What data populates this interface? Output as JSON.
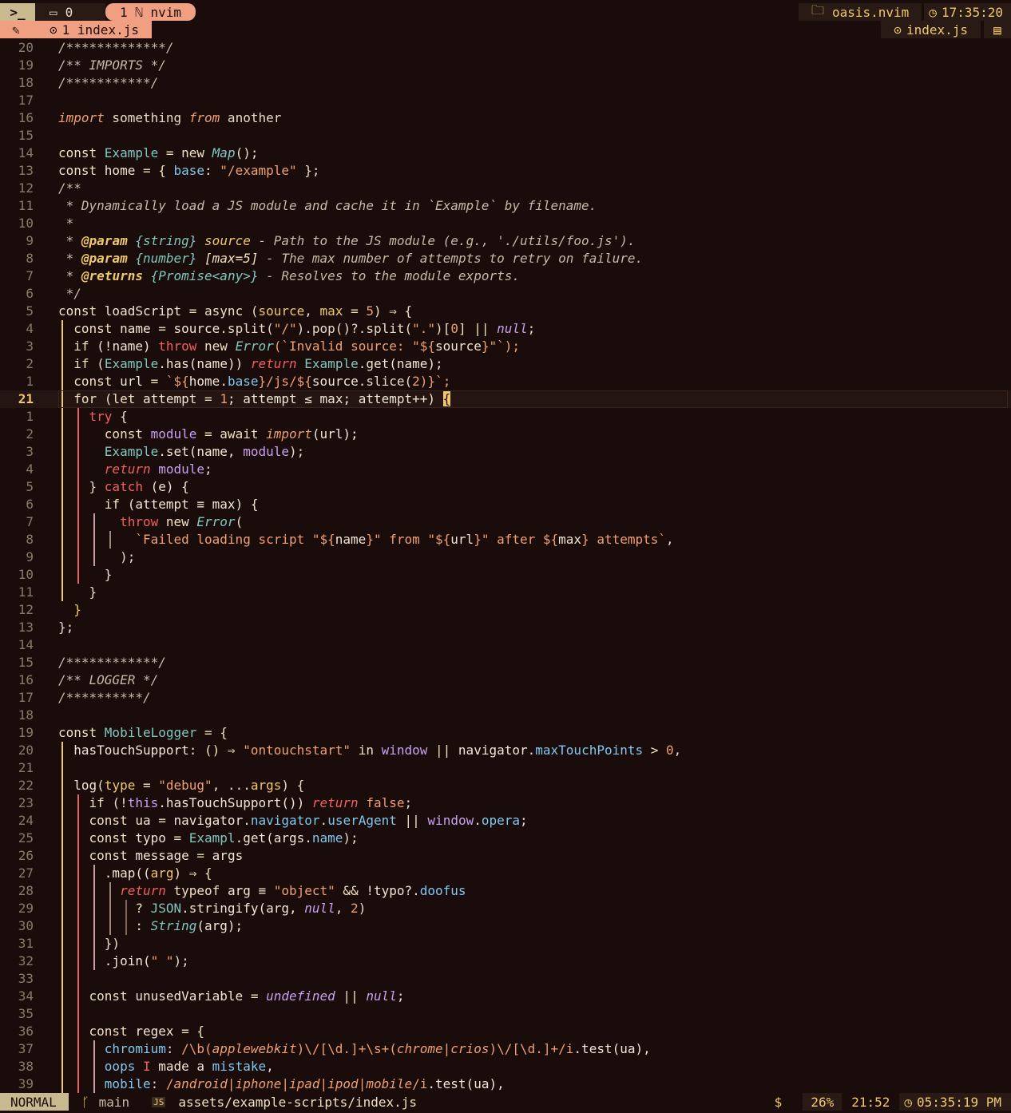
{
  "topbar": {
    "terminal_icon": "terminal-icon",
    "session_count": "0",
    "window_label": "1 ℕ nvim",
    "project": "oasis.nvim",
    "clock": "17:35:20"
  },
  "tabline": {
    "tab_label": "1 index.js",
    "right_file": "index.js"
  },
  "statusline": {
    "mode": "NORMAL",
    "branch": "main",
    "filepath": "assets/example-scripts/index.js",
    "dollar": "$",
    "percent": "26%",
    "position": "21:52",
    "time": "05:35:19 PM"
  },
  "colors": {
    "background": "#1a0c0a",
    "accent": "#f0c96a",
    "keyword": "#f0e0c0",
    "string": "#f0a070",
    "comment": "#c8b8a8",
    "function": "#80c8c0",
    "property": "#80c8f0",
    "purple": "#c8a0f0",
    "red": "#f06060"
  },
  "lines": [
    {
      "n": "20",
      "segs": [
        [
          "/*************/",
          "cm"
        ]
      ]
    },
    {
      "n": "19",
      "segs": [
        [
          "/** IMPORTS */",
          "cm"
        ]
      ]
    },
    {
      "n": "18",
      "segs": [
        [
          "/***********/",
          "cm"
        ]
      ]
    },
    {
      "n": "17",
      "segs": []
    },
    {
      "n": "16",
      "segs": [
        [
          "import",
          "kwi"
        ],
        [
          " something ",
          ""
        ],
        [
          "from",
          "kwi"
        ],
        [
          " another",
          ""
        ]
      ]
    },
    {
      "n": "15",
      "segs": []
    },
    {
      "n": "14",
      "segs": [
        [
          "const ",
          "kw"
        ],
        [
          "Example",
          "fn"
        ],
        [
          " = ",
          "op"
        ],
        [
          "new ",
          "kw"
        ],
        [
          "Map",
          "fni"
        ],
        [
          "();",
          "p"
        ]
      ]
    },
    {
      "n": "13",
      "segs": [
        [
          "const ",
          "kw"
        ],
        [
          "home",
          "id"
        ],
        [
          " = { ",
          "op"
        ],
        [
          "base",
          "pr"
        ],
        [
          ": ",
          "op"
        ],
        [
          "\"/example\"",
          "str"
        ],
        [
          " };",
          "p"
        ]
      ]
    },
    {
      "n": "12",
      "segs": [
        [
          "/**",
          "cm"
        ]
      ]
    },
    {
      "n": "11",
      "segs": [
        [
          " * Dynamically load a JS module and cache it in `Example` by filename.",
          "cm"
        ]
      ]
    },
    {
      "n": "10",
      "segs": [
        [
          " *",
          "cm"
        ]
      ]
    },
    {
      "n": "9",
      "segs": [
        [
          " * ",
          "cm"
        ],
        [
          "@param",
          "tag"
        ],
        [
          " ",
          "cm"
        ],
        [
          "{string}",
          "ty"
        ],
        [
          " ",
          "cm"
        ],
        [
          "source",
          "sym"
        ],
        [
          " - Path to the JS module (e.g., './utils/foo.js').",
          "cm"
        ]
      ]
    },
    {
      "n": "8",
      "segs": [
        [
          " * ",
          "cm"
        ],
        [
          "@param",
          "tag"
        ],
        [
          " ",
          "cm"
        ],
        [
          "{number}",
          "ty"
        ],
        [
          " ",
          "cm"
        ],
        [
          "[max=5]",
          "syb"
        ],
        [
          " - The max number of attempts to retry on failure.",
          "cm"
        ]
      ]
    },
    {
      "n": "7",
      "segs": [
        [
          " * ",
          "cm"
        ],
        [
          "@returns",
          "tag"
        ],
        [
          " ",
          "cm"
        ],
        [
          "{Promise<any>}",
          "ty"
        ],
        [
          " - Resolves to the module exports.",
          "cm"
        ]
      ]
    },
    {
      "n": "6",
      "segs": [
        [
          " */",
          "cm"
        ]
      ]
    },
    {
      "n": "5",
      "segs": [
        [
          "const ",
          "kw"
        ],
        [
          "loadScript",
          "id"
        ],
        [
          " = ",
          "op"
        ],
        [
          "async ",
          "kw"
        ],
        [
          "(",
          "p"
        ],
        [
          "source",
          "par"
        ],
        [
          ", ",
          "p"
        ],
        [
          "max",
          "par"
        ],
        [
          " = ",
          "op"
        ],
        [
          "5",
          "num"
        ],
        [
          ") ⇒ {",
          "op"
        ]
      ]
    },
    {
      "n": "4",
      "g": [
        1
      ],
      "segs": [
        [
          "  const ",
          "kw"
        ],
        [
          "name",
          "id"
        ],
        [
          " = ",
          "op"
        ],
        [
          "source",
          "id"
        ],
        [
          ".split(",
          "p"
        ],
        [
          "\"/\"",
          "str"
        ],
        [
          ").pop()?.split(",
          "p"
        ],
        [
          "\".\"",
          "str"
        ],
        [
          ")[",
          "p"
        ],
        [
          "0",
          "num"
        ],
        [
          "] || ",
          "op"
        ],
        [
          "null",
          "nul"
        ],
        [
          ";",
          "p"
        ]
      ]
    },
    {
      "n": "3",
      "g": [
        1
      ],
      "segs": [
        [
          "  if ",
          "kw"
        ],
        [
          "(!name) ",
          "id"
        ],
        [
          "throw ",
          "red"
        ],
        [
          "new ",
          "kw"
        ],
        [
          "Error",
          "fni"
        ],
        [
          "(`Invalid source: \"${",
          "str"
        ],
        [
          "source",
          "id"
        ],
        [
          "}\"`);",
          "str"
        ]
      ]
    },
    {
      "n": "2",
      "g": [
        1
      ],
      "segs": [
        [
          "  if ",
          "kw"
        ],
        [
          "(",
          "p"
        ],
        [
          "Example",
          "fn"
        ],
        [
          ".has(name)) ",
          "id"
        ],
        [
          "return ",
          "redi"
        ],
        [
          "Example",
          "fn"
        ],
        [
          ".get(name);",
          "id"
        ]
      ]
    },
    {
      "n": "1",
      "g": [
        1
      ],
      "segs": [
        [
          "  const ",
          "kw"
        ],
        [
          "url",
          "id"
        ],
        [
          " = ",
          "op"
        ],
        [
          "`${",
          "str"
        ],
        [
          "home",
          "id"
        ],
        [
          ".",
          "p"
        ],
        [
          "base",
          "pr"
        ],
        [
          "}/js/${",
          "str"
        ],
        [
          "source",
          "id"
        ],
        [
          ".slice(",
          "p"
        ],
        [
          "2",
          "num"
        ],
        [
          ")}`;",
          "str"
        ]
      ]
    },
    {
      "n": "21",
      "cur": true,
      "g": [
        1
      ],
      "segs": [
        [
          "  for ",
          "kw"
        ],
        [
          "(",
          "p"
        ],
        [
          "let ",
          "kw"
        ],
        [
          "attempt",
          "id"
        ],
        [
          " = ",
          "op"
        ],
        [
          "1",
          "num"
        ],
        [
          "; attempt ≤ max; attempt++) ",
          "id"
        ],
        [
          "{",
          "cursor"
        ]
      ]
    },
    {
      "n": "1",
      "g": [
        1,
        2
      ],
      "segs": [
        [
          "    try ",
          "red"
        ],
        [
          "{",
          "p"
        ]
      ]
    },
    {
      "n": "2",
      "g": [
        1,
        2
      ],
      "segs": [
        [
          "      const ",
          "kw"
        ],
        [
          "module",
          "pu"
        ],
        [
          " = ",
          "op"
        ],
        [
          "await ",
          "kw"
        ],
        [
          "import",
          "kwi"
        ],
        [
          "(url);",
          "id"
        ]
      ]
    },
    {
      "n": "3",
      "g": [
        1,
        2
      ],
      "segs": [
        [
          "      Example",
          "fn"
        ],
        [
          ".set(name, ",
          "id"
        ],
        [
          "module",
          "pu"
        ],
        [
          ");",
          "p"
        ]
      ]
    },
    {
      "n": "4",
      "g": [
        1,
        2
      ],
      "segs": [
        [
          "      return ",
          "redi"
        ],
        [
          "module",
          "pu"
        ],
        [
          ";",
          "p"
        ]
      ]
    },
    {
      "n": "5",
      "g": [
        1,
        2
      ],
      "segs": [
        [
          "    } ",
          "p"
        ],
        [
          "catch ",
          "red"
        ],
        [
          "(e) {",
          "id"
        ]
      ]
    },
    {
      "n": "6",
      "g": [
        1,
        2
      ],
      "segs": [
        [
          "      if ",
          "kw"
        ],
        [
          "(attempt ≡ max) {",
          "id"
        ]
      ]
    },
    {
      "n": "7",
      "g": [
        1,
        2,
        3
      ],
      "segs": [
        [
          "        throw ",
          "red"
        ],
        [
          "new ",
          "kw"
        ],
        [
          "Error",
          "fni"
        ],
        [
          "(",
          "p"
        ]
      ]
    },
    {
      "n": "8",
      "g": [
        1,
        2,
        3,
        4
      ],
      "segs": [
        [
          "          `Failed loading script \"${",
          "str"
        ],
        [
          "name",
          "id"
        ],
        [
          "}\" from \"${",
          "str"
        ],
        [
          "url",
          "id"
        ],
        [
          "}\" after ${",
          "str"
        ],
        [
          "max",
          "id"
        ],
        [
          "} attempts`",
          "str"
        ],
        [
          ",",
          "p"
        ]
      ]
    },
    {
      "n": "9",
      "g": [
        1,
        2,
        3
      ],
      "segs": [
        [
          "        );",
          "p"
        ]
      ]
    },
    {
      "n": "10",
      "g": [
        1,
        2
      ],
      "segs": [
        [
          "      }",
          "p"
        ]
      ]
    },
    {
      "n": "11",
      "g": [
        1
      ],
      "segs": [
        [
          "    }",
          "p"
        ]
      ]
    },
    {
      "n": "12",
      "g": [],
      "segs": [
        [
          "  }",
          "acc"
        ]
      ]
    },
    {
      "n": "13",
      "segs": [
        [
          "};",
          "p"
        ]
      ]
    },
    {
      "n": "14",
      "segs": []
    },
    {
      "n": "15",
      "segs": [
        [
          "/************/",
          "cm"
        ]
      ]
    },
    {
      "n": "16",
      "segs": [
        [
          "/** LOGGER */",
          "cm"
        ]
      ]
    },
    {
      "n": "17",
      "segs": [
        [
          "/**********/",
          "cm"
        ]
      ]
    },
    {
      "n": "18",
      "segs": []
    },
    {
      "n": "19",
      "segs": [
        [
          "const ",
          "kw"
        ],
        [
          "MobileLogger",
          "fn"
        ],
        [
          " = {",
          "op"
        ]
      ]
    },
    {
      "n": "20",
      "g": [
        1
      ],
      "segs": [
        [
          "  hasTouchSupport",
          "id"
        ],
        [
          ": () ⇒ ",
          "op"
        ],
        [
          "\"ontouchstart\"",
          "str"
        ],
        [
          " in ",
          "kw"
        ],
        [
          "window",
          "pu"
        ],
        [
          " || ",
          "op"
        ],
        [
          "navigator",
          "id"
        ],
        [
          ".",
          "p"
        ],
        [
          "maxTouchPoints",
          "pr"
        ],
        [
          " > ",
          "op"
        ],
        [
          "0",
          "num"
        ],
        [
          ",",
          "p"
        ]
      ]
    },
    {
      "n": "21",
      "g": [
        1
      ],
      "segs": []
    },
    {
      "n": "22",
      "g": [
        1
      ],
      "segs": [
        [
          "  log",
          "id"
        ],
        [
          "(",
          "p"
        ],
        [
          "type",
          "par"
        ],
        [
          " = ",
          "op"
        ],
        [
          "\"debug\"",
          "str"
        ],
        [
          ", ...",
          "p"
        ],
        [
          "args",
          "par"
        ],
        [
          ") {",
          "p"
        ]
      ]
    },
    {
      "n": "23",
      "g": [
        1,
        2
      ],
      "segs": [
        [
          "    if ",
          "kw"
        ],
        [
          "(!",
          "p"
        ],
        [
          "this",
          "pu"
        ],
        [
          ".hasTouchSupport()) ",
          "id"
        ],
        [
          "return ",
          "redi"
        ],
        [
          "false",
          "str"
        ],
        [
          ";",
          "p"
        ]
      ]
    },
    {
      "n": "24",
      "g": [
        1,
        2
      ],
      "segs": [
        [
          "    const ",
          "kw"
        ],
        [
          "ua",
          "id"
        ],
        [
          " = ",
          "op"
        ],
        [
          "navigator",
          "id"
        ],
        [
          ".",
          "p"
        ],
        [
          "navigator",
          "pr"
        ],
        [
          ".",
          "p"
        ],
        [
          "userAgent",
          "pr"
        ],
        [
          " || ",
          "op"
        ],
        [
          "window",
          "pu"
        ],
        [
          ".",
          "p"
        ],
        [
          "opera",
          "pr"
        ],
        [
          ";",
          "p"
        ]
      ]
    },
    {
      "n": "25",
      "g": [
        1,
        2
      ],
      "segs": [
        [
          "    const ",
          "kw"
        ],
        [
          "typo",
          "id"
        ],
        [
          " = ",
          "op"
        ],
        [
          "Exampl",
          "fn"
        ],
        [
          ".get(args.",
          "id"
        ],
        [
          "name",
          "pr"
        ],
        [
          ");",
          "p"
        ]
      ]
    },
    {
      "n": "26",
      "g": [
        1,
        2
      ],
      "segs": [
        [
          "    const ",
          "kw"
        ],
        [
          "message",
          "id"
        ],
        [
          " = ",
          "op"
        ],
        [
          "args",
          "id"
        ]
      ]
    },
    {
      "n": "27",
      "g": [
        1,
        2,
        3
      ],
      "segs": [
        [
          "      .map((",
          "id"
        ],
        [
          "arg",
          "par"
        ],
        [
          ") ⇒ {",
          "op"
        ]
      ]
    },
    {
      "n": "28",
      "g": [
        1,
        2,
        3,
        4
      ],
      "segs": [
        [
          "        return ",
          "redi"
        ],
        [
          "typeof ",
          "kw"
        ],
        [
          "arg ≡ ",
          "id"
        ],
        [
          "\"object\"",
          "str"
        ],
        [
          " && ",
          "op"
        ],
        [
          "!typo?.",
          "id"
        ],
        [
          "doofus",
          "pr"
        ]
      ]
    },
    {
      "n": "29",
      "g": [
        1,
        2,
        3,
        4,
        5
      ],
      "segs": [
        [
          "          ? ",
          "op"
        ],
        [
          "JSON",
          "fn"
        ],
        [
          ".stringify(arg, ",
          "id"
        ],
        [
          "null",
          "nul"
        ],
        [
          ", ",
          "p"
        ],
        [
          "2",
          "num"
        ],
        [
          ")",
          "p"
        ]
      ]
    },
    {
      "n": "30",
      "g": [
        1,
        2,
        3,
        4,
        5
      ],
      "segs": [
        [
          "          : ",
          "op"
        ],
        [
          "String",
          "fni"
        ],
        [
          "(arg);",
          "id"
        ]
      ]
    },
    {
      "n": "31",
      "g": [
        1,
        2,
        3
      ],
      "segs": [
        [
          "      })",
          "p"
        ]
      ]
    },
    {
      "n": "32",
      "g": [
        1,
        2,
        3
      ],
      "segs": [
        [
          "      .join(",
          "id"
        ],
        [
          "\" \"",
          "str"
        ],
        [
          ");",
          "p"
        ]
      ]
    },
    {
      "n": "33",
      "g": [
        1,
        2
      ],
      "segs": []
    },
    {
      "n": "34",
      "g": [
        1,
        2
      ],
      "segs": [
        [
          "    const ",
          "kw"
        ],
        [
          "unusedVariable",
          "id"
        ],
        [
          " = ",
          "op"
        ],
        [
          "undefined",
          "nul"
        ],
        [
          " || ",
          "op"
        ],
        [
          "null",
          "nul"
        ],
        [
          ";",
          "p"
        ]
      ]
    },
    {
      "n": "35",
      "g": [
        1,
        2
      ],
      "segs": []
    },
    {
      "n": "36",
      "g": [
        1,
        2
      ],
      "segs": [
        [
          "    const ",
          "kw"
        ],
        [
          "regex",
          "id"
        ],
        [
          " = {",
          "op"
        ]
      ]
    },
    {
      "n": "37",
      "g": [
        1,
        2,
        3
      ],
      "segs": [
        [
          "      chromium",
          "pr"
        ],
        [
          ": ",
          "p"
        ],
        [
          "/\\b(",
          "rx"
        ],
        [
          "applewebkit",
          "rxi"
        ],
        [
          ")\\/[\\d.]+\\s+(",
          "rx"
        ],
        [
          "chrome|crios",
          "rxi"
        ],
        [
          ")\\/[\\d.]+/i",
          "rx"
        ],
        [
          ".test(ua),",
          "id"
        ]
      ]
    },
    {
      "n": "38",
      "g": [
        1,
        2,
        3
      ],
      "segs": [
        [
          "      oops ",
          "pr"
        ],
        [
          "I ",
          "red"
        ],
        [
          "made a ",
          "id"
        ],
        [
          "mistake",
          "pr"
        ],
        [
          ",",
          "p"
        ]
      ]
    },
    {
      "n": "39",
      "g": [
        1,
        2,
        3
      ],
      "segs": [
        [
          "      mobile",
          "pr"
        ],
        [
          ": ",
          "p"
        ],
        [
          "/",
          "rx"
        ],
        [
          "android|iphone|ipad|ipod|mobile",
          "rxi"
        ],
        [
          "/i",
          "rx"
        ],
        [
          ".test(ua),",
          "id"
        ]
      ]
    }
  ]
}
